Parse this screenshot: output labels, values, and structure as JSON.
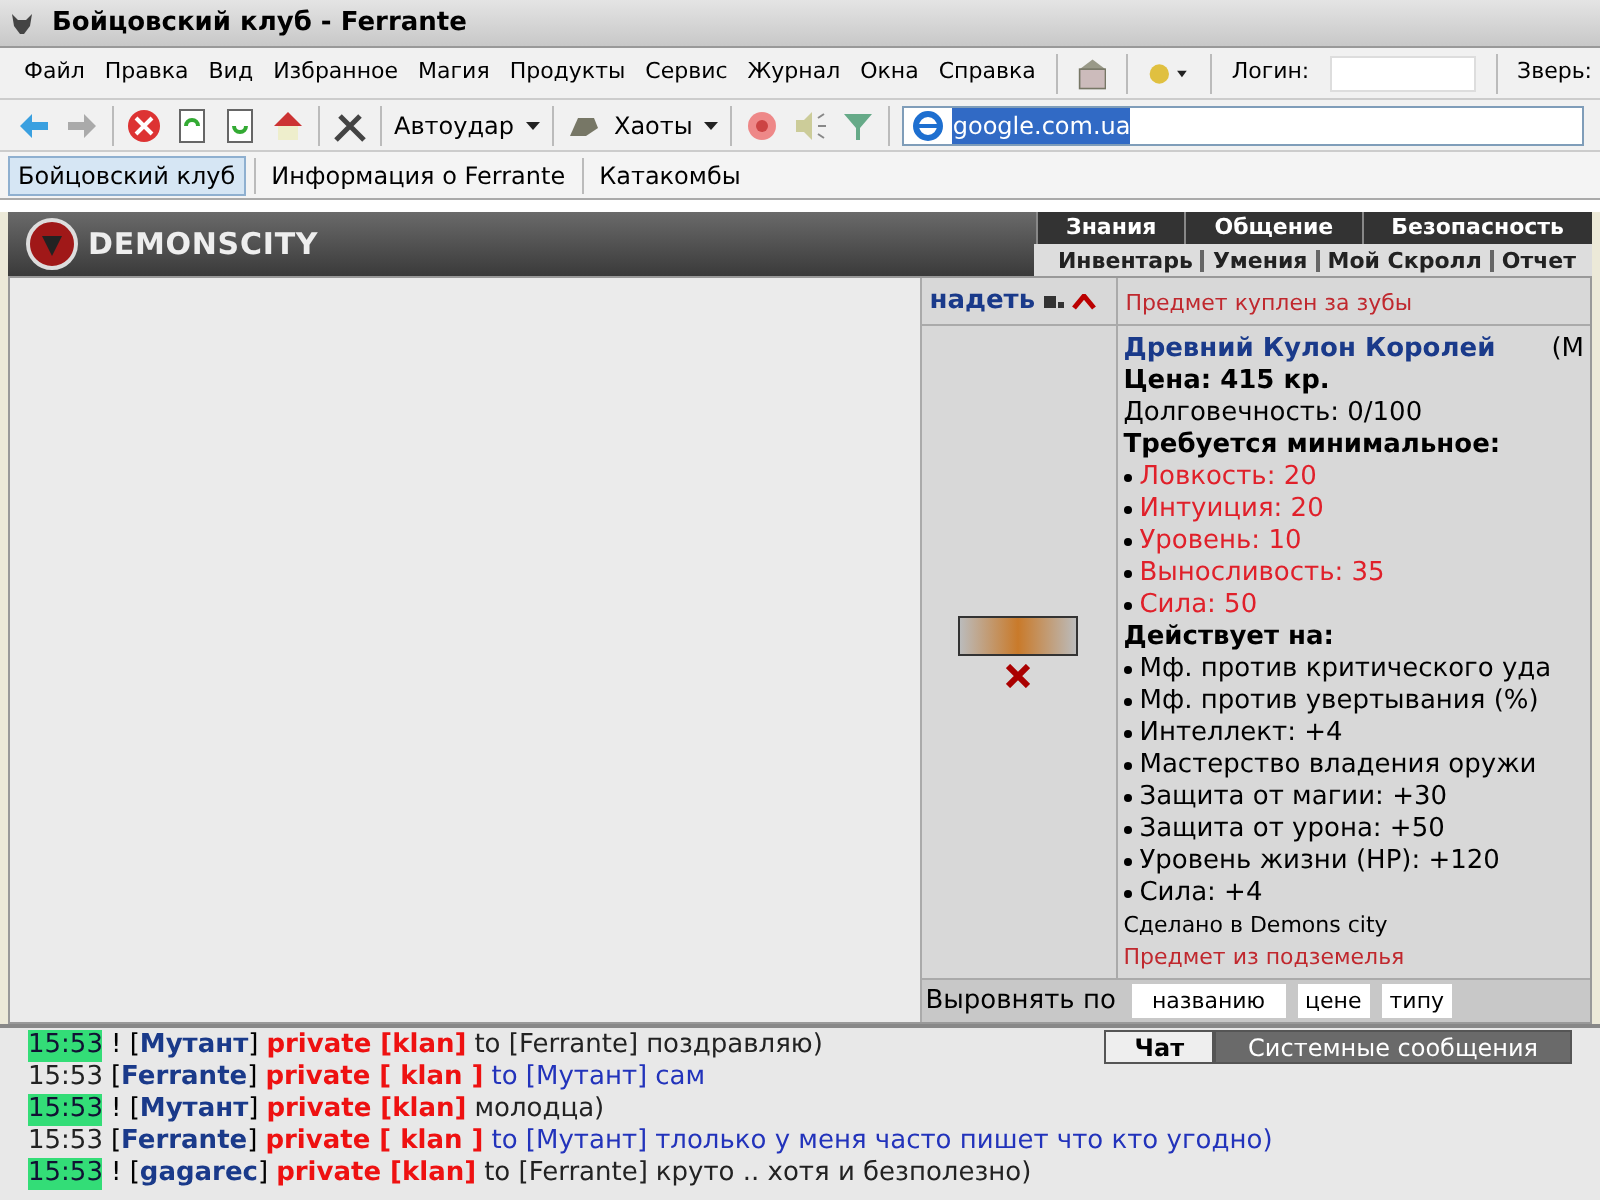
{
  "window": {
    "title": "Бойцовский клуб - Ferrante"
  },
  "menu": [
    "Файл",
    "Правка",
    "Вид",
    "Избранное",
    "Магия",
    "Продукты",
    "Сервис",
    "Журнал",
    "Окна",
    "Справка"
  ],
  "login": {
    "label": "Логин:",
    "pet_label": "Зверь:"
  },
  "toolbar": {
    "autohit": "Автоудар",
    "chaos": "Хаоты",
    "address": "google.com.ua"
  },
  "tabs": [
    {
      "label": "Бойцовский клуб",
      "selected": true
    },
    {
      "label": "Информация о Ferrante",
      "selected": false
    },
    {
      "label": "Катакомбы",
      "selected": false
    }
  ],
  "game": {
    "logo": "DEMONSCITY",
    "nav": [
      "Знания",
      "Общение",
      "Безопасность"
    ],
    "subnav": [
      "Инвентарь",
      "Умения",
      "Мой Скролл",
      "Отчет"
    ]
  },
  "item_top": {
    "action": "надеть",
    "note": "Предмет куплен за зубы"
  },
  "item": {
    "name": "Древний Кулон Королей",
    "name_rest": "(М",
    "price": "Цена: 415 кр.",
    "durability": "Долговечность: 0/100",
    "req_title": "Требуется минимальное:",
    "requirements": [
      "Ловкость: 20",
      "Интуиция: 20",
      "Уровень: 10",
      "Выносливость: 35",
      "Сила: 50"
    ],
    "effects_title": "Действует на:",
    "effects": [
      "Мф. против критического уда",
      "Мф. против увертывания (%)",
      "Интеллект: +4",
      "Мастерство владения оружи",
      "Защита от магии: +30",
      "Защита от урона: +50",
      "Уровень жизни (HP): +120",
      "Сила: +4"
    ],
    "made": "Сделано в Demons city",
    "origin": "Предмет из подземелья"
  },
  "sort": {
    "label": "Выровнять по",
    "buttons": [
      "названию",
      "цене",
      "типу"
    ]
  },
  "chat_tabs": [
    {
      "label": "Чат",
      "selected": true
    },
    {
      "label": "Системные сообщения",
      "selected": false
    }
  ],
  "chat": [
    {
      "time": "15:53",
      "highlighted": true,
      "nick": "! [**Мутант**]",
      "channel": "private [klan]",
      "target": "to [Ferrante]",
      "text": "поздравляю)",
      "own": false
    },
    {
      "time": "15:53",
      "highlighted": false,
      "nick": "[**Ferrante**]",
      "channel": "private [ klan ]",
      "target": "to [Мутант]",
      "text": "сам",
      "own": true
    },
    {
      "time": "15:53",
      "highlighted": true,
      "nick": "! [**Мутант**]",
      "channel": "private [klan]",
      "text": "молодца)",
      "own": false
    },
    {
      "time": "15:53",
      "highlighted": false,
      "nick": "[**Ferrante**]",
      "channel": "private [ klan ]",
      "target": "to [Мутант]",
      "text": "тлолько у меня часто пишет что кто угодно)",
      "own": true
    },
    {
      "time": "15:53",
      "highlighted": true,
      "nick": "! [**gagarec**]",
      "channel": "private [klan]",
      "target": "to [Ferrante]",
      "text": "круто .. хотя и безполезно)",
      "own": false
    }
  ]
}
